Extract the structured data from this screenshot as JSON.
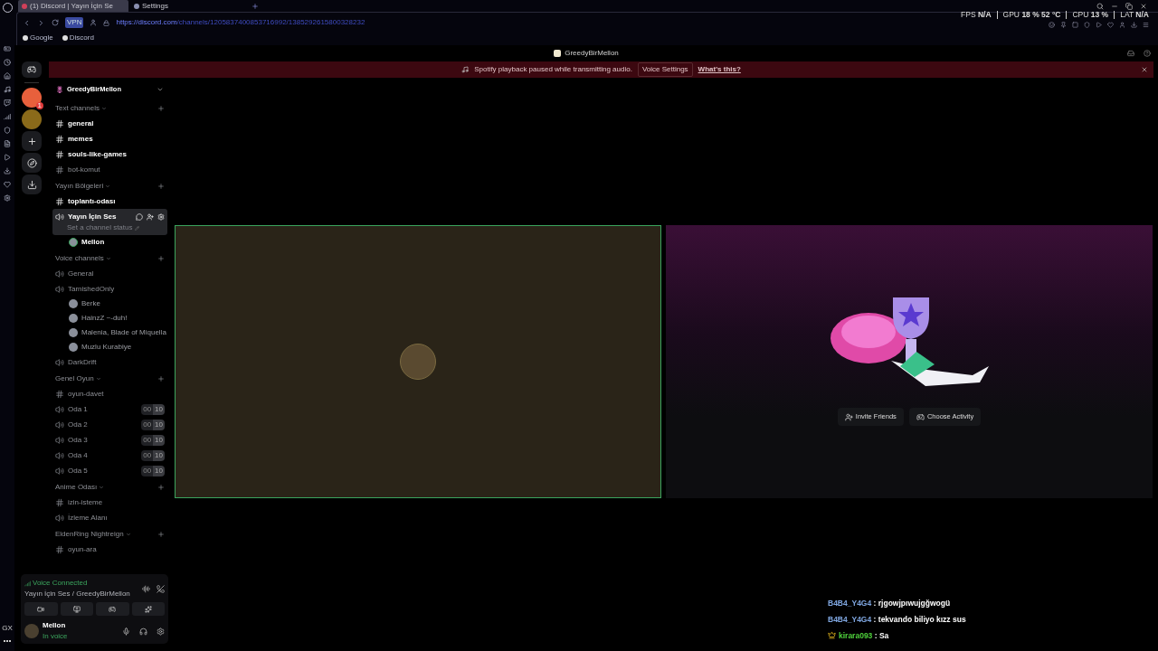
{
  "browser": {
    "tabs": [
      {
        "label": "(1) Discord | Yayın İçin Se",
        "selected": true
      },
      {
        "label": "Settings",
        "selected": false
      }
    ],
    "vpn": "VPN",
    "url_host": "https://discord.com",
    "url_path": "/channels/1205837400853716992/1385292615800328232",
    "bookmarks": [
      "Google",
      "Discord"
    ],
    "sidebar_badge": "GX"
  },
  "perf_overlay": [
    {
      "label": "FPS",
      "value": "N/A"
    },
    {
      "label": "GPU",
      "value": "18 % 52 °C"
    },
    {
      "label": "CPU",
      "value": "13 %"
    },
    {
      "label": "LAT",
      "value": "N/A"
    }
  ],
  "discord": {
    "window_title": "GreedyBirMellon",
    "banner": {
      "message": "Spotify playback paused while transmitting audio.",
      "button": "Voice Settings",
      "link": "What's this?"
    },
    "servers": [
      {
        "kind": "avatar",
        "badge": "1",
        "color": "#e8603c"
      },
      {
        "kind": "avatar",
        "color": "#8a6a1a"
      },
      {
        "kind": "add"
      },
      {
        "kind": "discover"
      },
      {
        "kind": "download"
      }
    ],
    "server_name": "GreedyBirMellon",
    "categories": [
      {
        "name": "Text channels",
        "channels": [
          {
            "kind": "text",
            "name": "general",
            "unread": true,
            "selected": false
          },
          {
            "kind": "text",
            "name": "memes",
            "unread": true,
            "selected": false
          },
          {
            "kind": "text",
            "name": "souls-like-games",
            "unread": true,
            "selected": false
          },
          {
            "kind": "text",
            "name": "bot-komut",
            "unread": false,
            "selected": false
          }
        ]
      },
      {
        "name": "Yayın Bölgeleri",
        "channels": [
          {
            "kind": "text",
            "name": "toplantı-odası",
            "unread": true,
            "selected": false
          },
          {
            "kind": "voice",
            "name": "Yayın İçin Ses",
            "unread": true,
            "selected": true,
            "status": "Set a channel status",
            "members": [
              {
                "name": "Mellon",
                "speaking": true
              }
            ]
          }
        ]
      },
      {
        "name": "Voice channels",
        "channels": [
          {
            "kind": "voice",
            "name": "General",
            "unread": false,
            "selected": false
          },
          {
            "kind": "voice",
            "name": "TarnishedOnly",
            "unread": false,
            "selected": false,
            "members": [
              {
                "name": "Berke",
                "speaking": false
              },
              {
                "name": "HainzZ ~-duh!",
                "speaking": false
              },
              {
                "name": "Malenia, Blade of Miquella",
                "speaking": false
              },
              {
                "name": "Muzlu Kurabiye",
                "speaking": false
              }
            ]
          },
          {
            "kind": "voice",
            "name": "DarkDrift",
            "unread": false,
            "selected": false
          }
        ]
      },
      {
        "name": "Genel Oyun",
        "channels": [
          {
            "kind": "text",
            "name": "oyun-davet",
            "unread": false,
            "selected": false
          },
          {
            "kind": "voice",
            "name": "Oda 1",
            "unread": false,
            "selected": false,
            "limit": [
              "00",
              "10"
            ]
          },
          {
            "kind": "voice",
            "name": "Oda 2",
            "unread": false,
            "selected": false,
            "limit": [
              "00",
              "10"
            ]
          },
          {
            "kind": "voice",
            "name": "Oda 3",
            "unread": false,
            "selected": false,
            "limit": [
              "00",
              "10"
            ]
          },
          {
            "kind": "voice",
            "name": "Oda 4",
            "unread": false,
            "selected": false,
            "limit": [
              "00",
              "10"
            ]
          },
          {
            "kind": "voice",
            "name": "Oda 5",
            "unread": false,
            "selected": false,
            "limit": [
              "00",
              "10"
            ]
          }
        ]
      },
      {
        "name": "Anime Odası",
        "channels": [
          {
            "kind": "text",
            "name": "izin-isteme",
            "unread": false,
            "selected": false
          },
          {
            "kind": "voice",
            "name": "İzleme Alanı",
            "unread": false,
            "selected": false
          }
        ]
      },
      {
        "name": "EldenRing Nightreign",
        "channels": [
          {
            "kind": "text",
            "name": "oyun-ara",
            "unread": false,
            "selected": false
          }
        ]
      }
    ],
    "voice_panel": {
      "status": "Voice Connected",
      "channel": "Yayın İçin Ses / GreedyBirMellon",
      "user": "Mellon",
      "user_status": "In voice"
    },
    "activity_buttons": [
      {
        "kind": "invite",
        "label": "Invite Friends"
      },
      {
        "kind": "activity",
        "label": "Choose Activity"
      }
    ]
  },
  "chat": [
    {
      "user": "B4B4_Y4G4",
      "separator": ":",
      "text": "rjgowjpıwujgğwogü",
      "color": "#7fa6e0",
      "badge": false
    },
    {
      "user": "B4B4_Y4G4",
      "separator": ":",
      "text": "tekvando biliyo kızz sus",
      "color": "#7fa6e0",
      "badge": false
    },
    {
      "user": "kirara093",
      "separator": ":",
      "text": "Sa",
      "color": "#4fd23c",
      "badge": true
    }
  ]
}
